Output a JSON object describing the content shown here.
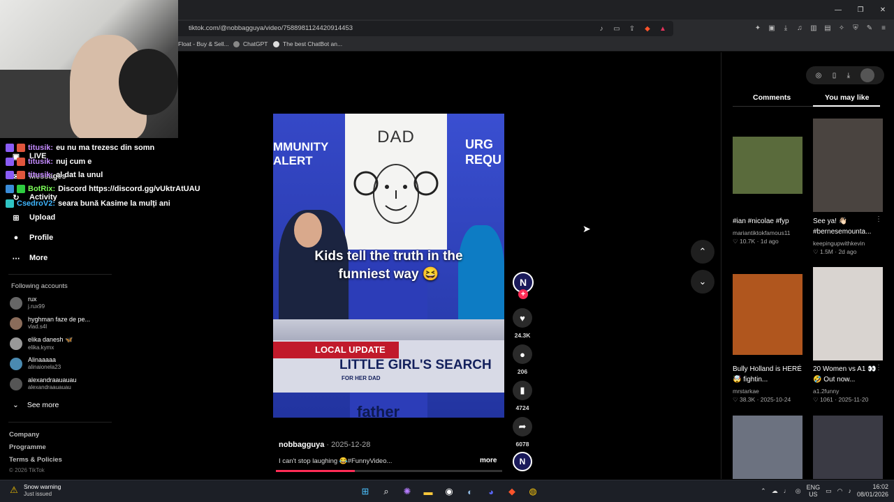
{
  "browser": {
    "url": "tiktok.com/@nobbagguya/video/7588981124420914453",
    "bookmarks": [
      "Float - Buy & Sell...",
      "ChatGPT",
      "The best ChatBot an..."
    ],
    "window_controls": [
      "—",
      "❐",
      "✕"
    ]
  },
  "sidebar": {
    "items": [
      {
        "label": "LIVE",
        "icon": "live-icon"
      },
      {
        "label": "Messages",
        "icon": "messages-icon"
      },
      {
        "label": "Activity",
        "icon": "activity-icon"
      },
      {
        "label": "Upload",
        "icon": "upload-icon"
      },
      {
        "label": "Profile",
        "icon": "profile-icon"
      },
      {
        "label": "More",
        "icon": "more-icon"
      }
    ],
    "following_title": "Following accounts",
    "accounts": [
      {
        "name": "rux",
        "handle": "j.rux99"
      },
      {
        "name": "hyghman faze de pe...",
        "handle": "vlad.s4l"
      },
      {
        "name": "elika danesh 🦋",
        "handle": "elika.kymx"
      },
      {
        "name": "Alinaaaaa",
        "handle": "alinaionela23"
      },
      {
        "name": "alexandraauauau",
        "handle": "alexandraauauau"
      }
    ],
    "see_more": "See more",
    "footer": [
      "Company",
      "Programme",
      "Terms & Policies"
    ],
    "copyright": "© 2026 TikTok"
  },
  "chat": [
    {
      "user": "titusik:",
      "msg": "eu nu ma trezesc din somn",
      "color": "#c58bff"
    },
    {
      "user": "titusik:",
      "msg": "nuj cum e",
      "color": "#c58bff"
    },
    {
      "user": "titusik:",
      "msg": "al dat la unul",
      "color": "#c58bff"
    },
    {
      "user": "BotRix:",
      "msg": "Discord https://discord.gg/vUktrAtUAU",
      "color": "#7cfc5a"
    },
    {
      "user": "CsedroV2:",
      "msg": "seara bună Kasime la mulți ani",
      "color": "#3fb6ff"
    }
  ],
  "video": {
    "alert_left": "MMUNITY\nALERT",
    "alert_right": "URG\nREQU",
    "paper_text": "DAD",
    "caption_line1": "Kids tell the truth in the",
    "caption_line2": "funniest way 😆",
    "lower_tag": "LOCAL UPDATE",
    "lower_headline": "LITTLE GIRL'S SEARCH",
    "lower_sub": "FOR HER DAD",
    "bottom_word": "father",
    "author": "nobbagguya",
    "date": "· 2025-12-28",
    "description": "I can't stop laughing 😂#FunnyVideo...",
    "more": "more",
    "progress": 0.35
  },
  "actions": {
    "avatar_letter": "N",
    "likes": "24.3K",
    "comments": "206",
    "saves": "4724",
    "shares": "6078"
  },
  "right_panel": {
    "tabs": [
      "Comments",
      "You may like"
    ],
    "cards": [
      {
        "title": "#ian #nicolae #fyp",
        "author": "mariantiktokfamous11",
        "likes": "10.7K",
        "date": "1d ago",
        "color": "#5a6b3c"
      },
      {
        "title": "See ya! 👋🏻 #bernesemounta...",
        "author": "keepingupwithkevin",
        "likes": "1.5M",
        "date": "2d ago",
        "color": "#4a4440"
      },
      {
        "title": "Bully Holland is HERE 🤯 fightin...",
        "author": "mrstarkae",
        "likes": "38.3K",
        "date": "2025-10-24",
        "color": "#b0561e"
      },
      {
        "title": "20 Women vs A1 👀 🤣 Out now...",
        "author": "a1.2funny",
        "likes": "1061",
        "date": "2025-11-20",
        "color": "#d9d4d0"
      },
      {
        "title": "",
        "author": "",
        "likes": "",
        "date": "",
        "color": "#6c7280"
      },
      {
        "title": "",
        "author": "",
        "likes": "",
        "date": "",
        "color": "#3a3a44"
      }
    ]
  },
  "taskbar": {
    "weather_title": "Snow warning",
    "weather_sub": "Just issued",
    "lang1": "ENG",
    "lang2": "US",
    "time": "16:02",
    "date": "08/01/2026"
  }
}
